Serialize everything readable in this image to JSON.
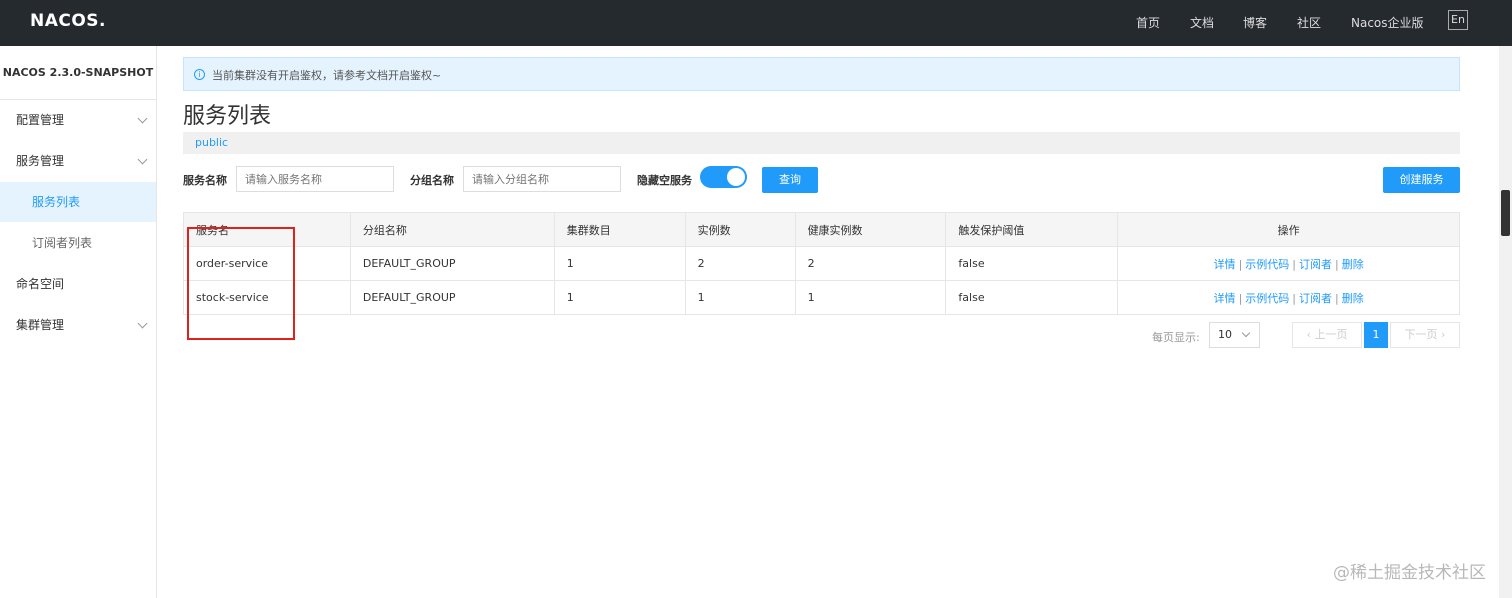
{
  "topbar": {
    "logo": "NACOS.",
    "nav": [
      "首页",
      "文档",
      "博客",
      "社区",
      "Nacos企业版"
    ],
    "lang": "En"
  },
  "sidebar": {
    "title": "NACOS 2.3.0-SNAPSHOT",
    "items": [
      {
        "label": "配置管理"
      },
      {
        "label": "服务管理"
      },
      {
        "label": "服务列表"
      },
      {
        "label": "订阅者列表"
      },
      {
        "label": "命名空间"
      },
      {
        "label": "集群管理"
      }
    ]
  },
  "alert": {
    "icon": "info-icon",
    "text": "当前集群没有开启鉴权，请参考文档开启鉴权~"
  },
  "page": {
    "title": "服务列表",
    "namespace": "public"
  },
  "filters": {
    "service_name_label": "服务名称",
    "service_name_placeholder": "请输入服务名称",
    "group_name_label": "分组名称",
    "group_name_placeholder": "请输入分组名称",
    "hide_empty_label": "隐藏空服务",
    "hide_empty_on": true,
    "query_button": "查询",
    "create_button": "创建服务"
  },
  "table": {
    "headers": [
      "服务名",
      "分组名称",
      "集群数目",
      "实例数",
      "健康实例数",
      "触发保护阈值",
      "操作"
    ],
    "rows": [
      {
        "name": "order-service",
        "group": "DEFAULT_GROUP",
        "clusters": "1",
        "instances": "2",
        "healthy": "2",
        "protect": "false"
      },
      {
        "name": "stock-service",
        "group": "DEFAULT_GROUP",
        "clusters": "1",
        "instances": "1",
        "healthy": "1",
        "protect": "false"
      }
    ],
    "ops": {
      "detail": "详情",
      "sample": "示例代码",
      "subscribers": "订阅者",
      "delete": "删除",
      "sep": "|"
    }
  },
  "pager": {
    "label": "每页显示:",
    "page_size": "10",
    "prev": "上一页",
    "current": "1",
    "next": "下一页"
  },
  "watermark": "@稀土掘金技术社区",
  "colors": {
    "accent": "#209bfa",
    "topbar": "#252a2f",
    "highlight": "#e0201a"
  }
}
